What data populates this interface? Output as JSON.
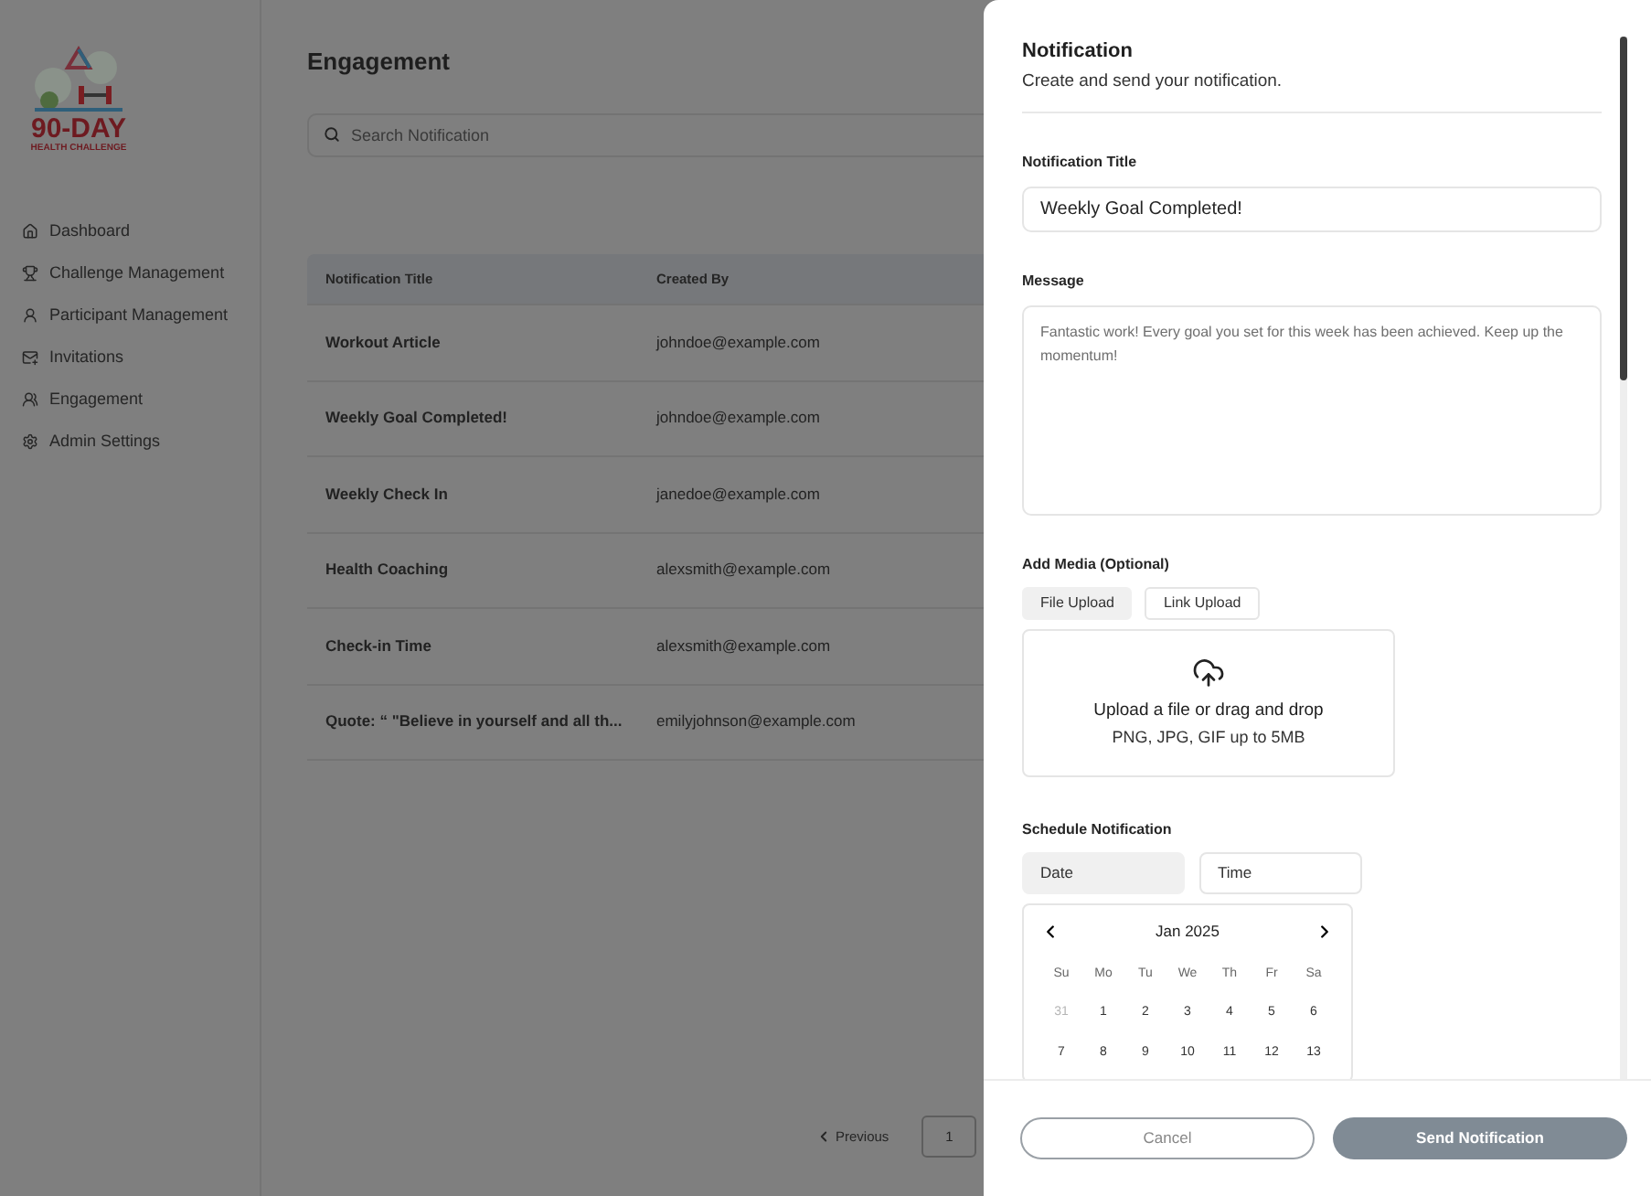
{
  "logo": {
    "title": "90-DAY",
    "subtitle": "HEALTH CHALLENGE"
  },
  "sidebar": {
    "items": [
      {
        "label": "Dashboard"
      },
      {
        "label": "Challenge Management"
      },
      {
        "label": "Participant Management"
      },
      {
        "label": "Invitations"
      },
      {
        "label": "Engagement"
      },
      {
        "label": "Admin Settings"
      }
    ]
  },
  "page": {
    "title": "Engagement",
    "search": {
      "placeholder": "Search Notification"
    }
  },
  "table": {
    "columns": [
      "Notification Title",
      "Created By"
    ],
    "rows": [
      [
        "Workout Article",
        "johndoe@example.com"
      ],
      [
        "Weekly Goal Completed!",
        "johndoe@example.com"
      ],
      [
        "Weekly Check In",
        "janedoe@example.com"
      ],
      [
        "Health Coaching",
        "alexsmith@example.com"
      ],
      [
        "Check-in Time",
        "alexsmith@example.com"
      ],
      [
        "Quote: “ \"Believe in yourself and all th...",
        "emilyjohnson@example.com"
      ]
    ]
  },
  "pagination": {
    "previous": "Previous",
    "page": "1"
  },
  "drawer": {
    "title": "Notification",
    "subtitle": "Create and send your notification.",
    "title_field": {
      "label": "Notification Title",
      "value": "Weekly Goal Completed!"
    },
    "message_field": {
      "label": "Message",
      "value": "Fantastic work! Every goal you set for this week has been achieved. Keep up the momentum!"
    },
    "media": {
      "label": "Add Media (Optional)",
      "tabs": [
        {
          "label": "File Upload",
          "selected": true
        },
        {
          "label": "Link Upload",
          "selected": false
        }
      ],
      "upload_text": "Upload a file or drag and drop",
      "upload_hint": "PNG, JPG, GIF up to 5MB"
    },
    "schedule": {
      "label": "Schedule Notification",
      "tabs": [
        {
          "label": "Date",
          "selected": true
        },
        {
          "label": "Time",
          "selected": false
        }
      ],
      "calendar": {
        "month": "Jan 2025",
        "weekdays": [
          "Su",
          "Mo",
          "Tu",
          "We",
          "Th",
          "Fr",
          "Sa"
        ],
        "weeks": [
          [
            {
              "day": "31",
              "muted": true
            },
            {
              "day": "1",
              "muted": false
            },
            {
              "day": "2",
              "muted": false
            },
            {
              "day": "3",
              "muted": false
            },
            {
              "day": "4",
              "muted": false
            },
            {
              "day": "5",
              "muted": false
            },
            {
              "day": "6",
              "muted": false
            }
          ],
          [
            {
              "day": "7",
              "muted": false
            },
            {
              "day": "8",
              "muted": false
            },
            {
              "day": "9",
              "muted": false
            },
            {
              "day": "10",
              "muted": false
            },
            {
              "day": "11",
              "muted": false
            },
            {
              "day": "12",
              "muted": false
            },
            {
              "day": "13",
              "muted": false
            }
          ]
        ]
      }
    },
    "buttons": {
      "cancel": "Cancel",
      "send": "Send Notification"
    }
  }
}
